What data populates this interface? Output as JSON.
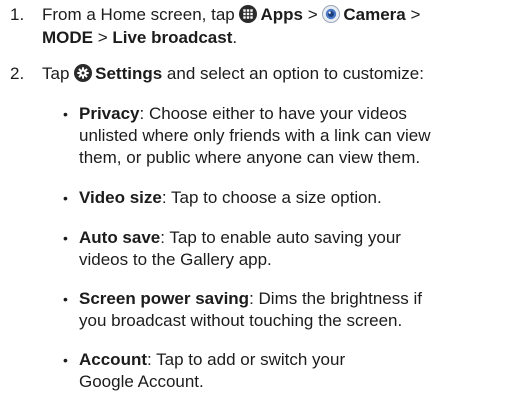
{
  "steps": [
    {
      "number": "1.",
      "text1": "From a Home screen, tap ",
      "apps_label": "Apps",
      "sep1": " > ",
      "camera_label": "Camera",
      "sep2": " >",
      "mode_label": "MODE",
      "sep3": " > ",
      "live_label": "Live broadcast",
      "end": "."
    },
    {
      "number": "2.",
      "text1": "Tap ",
      "settings_label": "Settings",
      "text2": " and select an option to customize:"
    }
  ],
  "options": [
    {
      "term": "Privacy",
      "line1": ": Choose either to have your videos",
      "line2": "unlisted where only friends with a link can view",
      "line3": "them, or public where anyone can view them."
    },
    {
      "term": "Video size",
      "line1": ": Tap to choose a size option."
    },
    {
      "term": "Auto save",
      "line1": ": Tap to enable auto saving your",
      "line2": "videos to the Gallery app."
    },
    {
      "term": "Screen power saving",
      "line1": ": Dims the brightness if",
      "line2": "you broadcast without touching the screen."
    },
    {
      "term": "Account",
      "line1": ": Tap to add or switch your",
      "line2": "Google Account."
    }
  ],
  "bullet_char": "•",
  "icons": {
    "apps": "apps-grid-icon",
    "camera": "camera-icon",
    "settings": "settings-gear-icon"
  }
}
